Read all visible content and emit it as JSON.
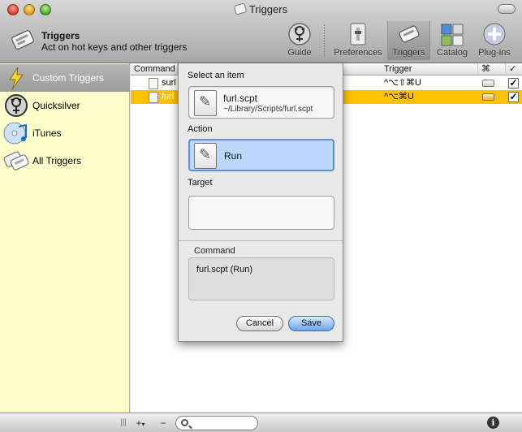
{
  "window": {
    "title": "Triggers"
  },
  "header": {
    "title": "Triggers",
    "subtitle": "Act on hot keys and other triggers"
  },
  "toolbar": {
    "items": [
      {
        "label": "Guide",
        "icon": "guide-icon"
      },
      {
        "label": "Preferences",
        "icon": "preferences-icon"
      },
      {
        "label": "Triggers",
        "icon": "triggers-icon",
        "selected": true
      },
      {
        "label": "Catalog",
        "icon": "catalog-icon"
      },
      {
        "label": "Plug-ins",
        "icon": "plugins-icon"
      }
    ]
  },
  "sidebar": {
    "items": [
      {
        "label": "Custom Triggers",
        "icon": "lightning-icon",
        "selected": true
      },
      {
        "label": "Quicksilver",
        "icon": "quicksilver-icon"
      },
      {
        "label": "iTunes",
        "icon": "itunes-icon"
      },
      {
        "label": "All Triggers",
        "icon": "all-triggers-icon"
      }
    ]
  },
  "table": {
    "columns": [
      "Command",
      "Trigger",
      "⌘",
      "✓"
    ],
    "rows": [
      {
        "command": "surl",
        "trigger": "^⌥⇧⌘U",
        "checked": "✓"
      },
      {
        "command": "furl",
        "trigger": "^⌥⌘U",
        "checked": "✓",
        "selected": true
      }
    ]
  },
  "sheet": {
    "select_label": "Select an item",
    "item_name": "furl.scpt",
    "item_path": "~/Library/Scripts/furl.scpt",
    "action_label": "Action",
    "action_name": "Run",
    "target_label": "Target",
    "command_label": "Command",
    "command_text": "furl.scpt (Run)",
    "cancel_label": "Cancel",
    "save_label": "Save"
  },
  "bottombar": {
    "add_label": "+",
    "menu_arrow": "▾",
    "remove_label": "−",
    "info_label": "i",
    "grip_label": "|||"
  },
  "colors": {
    "sidebar_bg": "#ffffcc",
    "selected_row": "#ffc000",
    "save_button": "#6ca7ea"
  }
}
